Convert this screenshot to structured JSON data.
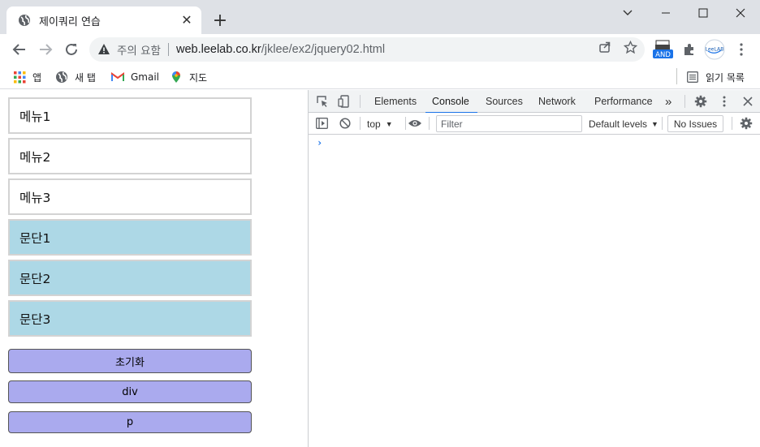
{
  "browser": {
    "tab_title": "제이쿼리 연습",
    "tab_close": "✕",
    "new_tab": "+",
    "omnibox": {
      "security_label": "주의 요함",
      "url_host": "web.leelab.co.kr",
      "url_path": "/jklee/ex2/jquery02.html"
    },
    "extensions": [
      "AND",
      "LeeLAB"
    ]
  },
  "bookmarks": {
    "items": [
      {
        "label": "앱",
        "icon": "apps-grid-icon"
      },
      {
        "label": "새 탭",
        "icon": "globe-icon"
      },
      {
        "label": "Gmail",
        "icon": "gmail-icon"
      },
      {
        "label": "지도",
        "icon": "maps-pin-icon"
      }
    ],
    "reading_list": "읽기 목록"
  },
  "page": {
    "menus": [
      "메뉴1",
      "메뉴2",
      "메뉴3"
    ],
    "paragraphs": [
      "문단1",
      "문단2",
      "문단3"
    ],
    "buttons": [
      "초기화",
      "div",
      "p"
    ],
    "colors": {
      "paragraph_bg": "#add8e6",
      "button_bg": "#aaaaee",
      "box_border": "#d3d3d3"
    }
  },
  "devtools": {
    "tabs": [
      "Elements",
      "Console",
      "Sources",
      "Network",
      "Performance"
    ],
    "active_tab": "Console",
    "more_tabs": "»",
    "context": "top",
    "filter_placeholder": "Filter",
    "levels": "Default levels",
    "issues": "No Issues",
    "prompt": "›",
    "accent": "#1a73e8"
  }
}
